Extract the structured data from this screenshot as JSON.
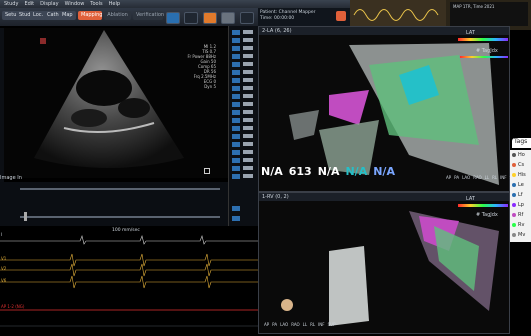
{
  "menu": [
    "Study",
    "Edit",
    "Display",
    "Window",
    "Tools",
    "Help"
  ],
  "toolbar": {
    "buttons": [
      "Setup",
      "Study",
      "Loc.",
      "Cath.",
      "Map"
    ],
    "mapping_label": "Mapping",
    "ablation_label": "Ablation",
    "verification_label": "Verification"
  },
  "status": {
    "line1": "Patient: Channel    Mapper",
    "line2": "Time: 00:00:00"
  },
  "echo": {
    "label": "Image In",
    "params": [
      "MI 1.2",
      "TIS 0.7",
      "Fr Power 88Hz",
      "Gain 50",
      "Comp 65",
      "DR 56",
      "Frq 2.5MHz",
      "ECG 0",
      "Dyn 5"
    ]
  },
  "ecg": {
    "speed_label": "100 mm/sec",
    "channels": [
      "I",
      "II",
      "III",
      "V1",
      "V2",
      "V6"
    ],
    "bottom_label": "AP 1-2 (NG)"
  },
  "top_map": {
    "title": "2-LA (6, 26)",
    "lat_label": "LAT",
    "tag_label": "# TagJdx",
    "values": [
      {
        "label": "LAT",
        "value": "N/A"
      },
      {
        "label": "",
        "value": "613"
      },
      {
        "label": "",
        "value": "N/A"
      },
      {
        "label": "",
        "value": "N/A"
      },
      {
        "label": "",
        "value": "N/A"
      }
    ],
    "views": [
      "IN",
      "AP",
      "PA",
      "LAO",
      "RAO",
      "LL",
      "RL",
      "INF",
      "SUP"
    ]
  },
  "bottom_map": {
    "title": "1-RV (0, 2)",
    "lat_label": "LAT",
    "tag_label": "# TagJdx",
    "views": [
      "AP",
      "PA",
      "LAO",
      "RAO",
      "LL",
      "RL",
      "INF",
      "SUP"
    ]
  },
  "sidebar": {
    "title": "Tags",
    "items": [
      "Ho",
      "Cs",
      "His",
      "Le",
      "Lf",
      "Lp",
      "Rf",
      "Rv",
      "Mv"
    ]
  },
  "colors": {
    "accent": "#e0603a",
    "lat_gradient": [
      "#ff2a2a",
      "#ffd12a",
      "#2aff4a",
      "#2ab6ff",
      "#8a2aff"
    ],
    "tissue": "#9aa09e",
    "mesh_green": "#5fbf7c",
    "magenta": "#c04cc0",
    "cyan": "#25c0c8"
  }
}
